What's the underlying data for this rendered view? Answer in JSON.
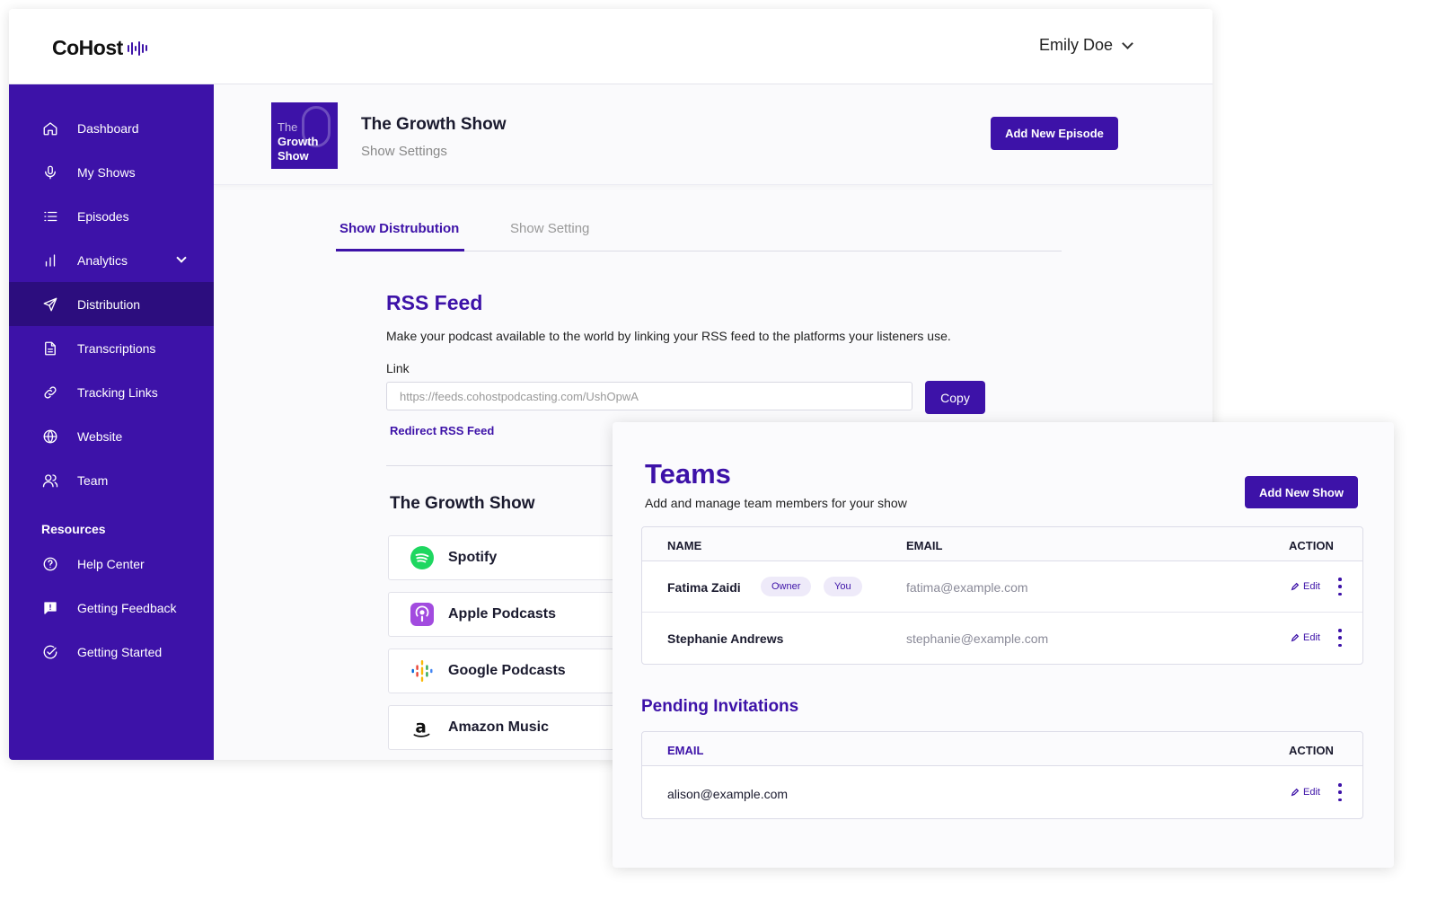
{
  "app": {
    "logo_bold": "Co",
    "logo_light": "Host",
    "user_name": "Emily Doe"
  },
  "sidebar": {
    "items": [
      {
        "label": "Dashboard",
        "icon": "home-icon"
      },
      {
        "label": "My Shows",
        "icon": "microphone-icon"
      },
      {
        "label": "Episodes",
        "icon": "list-icon"
      },
      {
        "label": "Analytics",
        "icon": "bar-chart-icon"
      },
      {
        "label": "Distribution",
        "icon": "send-icon"
      },
      {
        "label": "Transcriptions",
        "icon": "document-icon"
      },
      {
        "label": "Tracking Links",
        "icon": "link-icon"
      },
      {
        "label": "Website",
        "icon": "globe-icon"
      },
      {
        "label": "Team",
        "icon": "users-icon"
      }
    ],
    "resources_heading": "Resources",
    "resources": [
      {
        "label": "Help Center",
        "icon": "help-circle-icon"
      },
      {
        "label": "Getting Feedback",
        "icon": "feedback-icon"
      },
      {
        "label": "Getting Started",
        "icon": "check-circle-icon"
      }
    ],
    "active": "Distribution"
  },
  "show": {
    "cover_line1": "The",
    "cover_line2": "Growth",
    "cover_line3": "Show",
    "title": "The Growth Show",
    "subtitle": "Show Settings",
    "add_episode_label": "Add New Episode"
  },
  "tabs": [
    {
      "label": "Show Distrubution",
      "active": true
    },
    {
      "label": "Show Setting",
      "active": false
    }
  ],
  "rss": {
    "title": "RSS Feed",
    "description": "Make your podcast available to the world by linking your RSS feed to the platforms your listeners use.",
    "link_label": "Link",
    "link_value": "https://feeds.cohostpodcasting.com/UshOpwA",
    "copy_label": "Copy",
    "redirect_label": "Redirect RSS Feed"
  },
  "platforms": {
    "title": "The Growth Show",
    "items": [
      {
        "label": "Spotify",
        "icon": "spotify-icon"
      },
      {
        "label": "Apple Podcasts",
        "icon": "apple-podcasts-icon"
      },
      {
        "label": "Google Podcasts",
        "icon": "google-podcasts-icon"
      },
      {
        "label": "Amazon Music",
        "icon": "amazon-icon"
      }
    ]
  },
  "teams": {
    "title": "Teams",
    "subtitle": "Add and manage team members for your show",
    "add_show_label": "Add New Show",
    "columns": {
      "name": "NAME",
      "email": "EMAIL",
      "action": "ACTION"
    },
    "members": [
      {
        "name": "Fatima Zaidi",
        "email": "fatima@example.com",
        "badges": [
          "Owner",
          "You"
        ],
        "edit_label": "Edit"
      },
      {
        "name": "Stephanie Andrews",
        "email": "stephanie@example.com",
        "badges": [],
        "edit_label": "Edit"
      }
    ],
    "pending_title": "Pending Invitations",
    "pending_columns": {
      "email": "EMAIL",
      "action": "ACTION"
    },
    "pending": [
      {
        "email": "alison@example.com",
        "edit_label": "Edit"
      }
    ]
  },
  "colors": {
    "brand": "#3d12a8",
    "brand_dark": "#2c0d7e"
  }
}
